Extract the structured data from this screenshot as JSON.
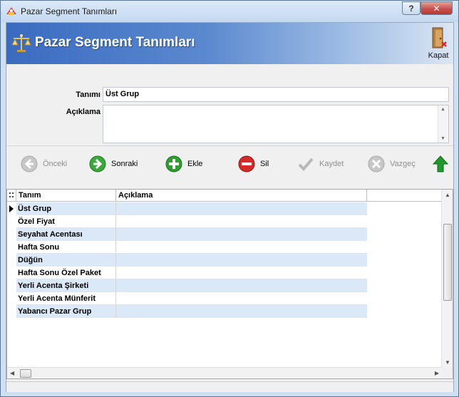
{
  "window": {
    "title": "Pazar Segment Tanımları",
    "help_label": "?",
    "close_label": "✕"
  },
  "header": {
    "title": "Pazar Segment Tanımları",
    "close_button_label": "Kapat"
  },
  "form": {
    "tanim_label": "Tanımı",
    "tanim_value": "Üst Grup",
    "aciklama_label": "Açıklama",
    "aciklama_value": ""
  },
  "toolbar": {
    "previous_label": "Önceki",
    "next_label": "Sonraki",
    "add_label": "Ekle",
    "delete_label": "Sil",
    "save_label": "Kaydet",
    "cancel_label": "Vazgeç"
  },
  "grid": {
    "columns": [
      "Tanım",
      "Açıklama"
    ],
    "rows": [
      {
        "tanim": "Üst Grup",
        "aciklama": ""
      },
      {
        "tanim": "Özel Fiyat",
        "aciklama": ""
      },
      {
        "tanim": "Seyahat Acentası",
        "aciklama": ""
      },
      {
        "tanim": "Hafta Sonu",
        "aciklama": ""
      },
      {
        "tanim": "Düğün",
        "aciklama": ""
      },
      {
        "tanim": "Hafta Sonu Özel Paket",
        "aciklama": ""
      },
      {
        "tanim": "Yerli Acenta Şirketi",
        "aciklama": ""
      },
      {
        "tanim": "Yerli Acenta Münferit",
        "aciklama": ""
      },
      {
        "tanim": "Yabancı Pazar Grup",
        "aciklama": ""
      }
    ]
  },
  "colors": {
    "header_gradient_start": "#3a6bc0",
    "row_alternate": "#dbe8f7",
    "next_icon": "#3aa83a",
    "add_icon": "#2e9e2e",
    "delete_icon": "#d42a2a",
    "up_arrow": "#1f9a2a"
  }
}
